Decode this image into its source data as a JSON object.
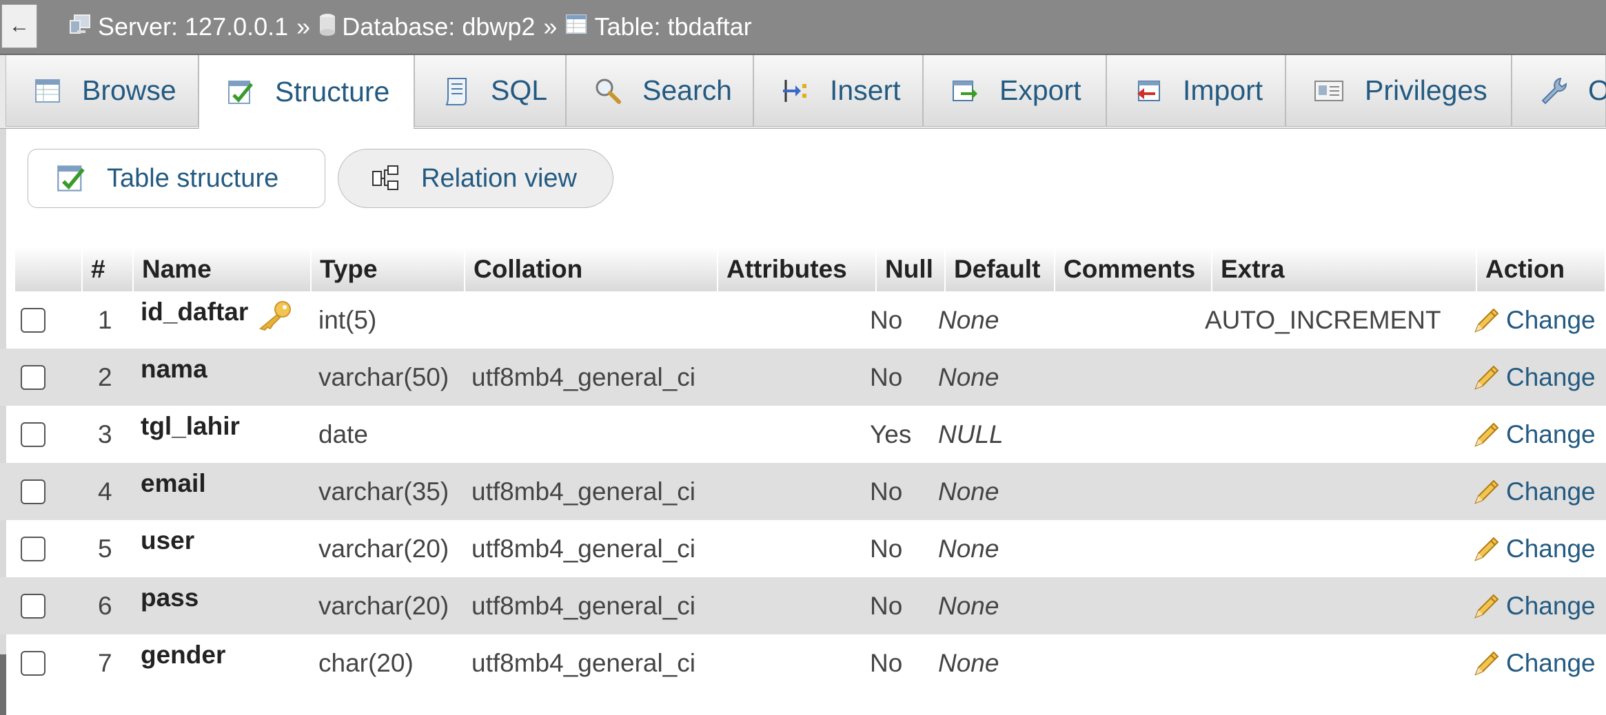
{
  "breadcrumb": {
    "back": "←",
    "server": "Server: 127.0.0.1",
    "database": "Database: dbwp2",
    "table": "Table: tbdaftar",
    "separator": "»"
  },
  "tabs": [
    {
      "label": "Browse",
      "icon": "browse-icon"
    },
    {
      "label": "Structure",
      "icon": "structure-icon",
      "active": true
    },
    {
      "label": "SQL",
      "icon": "sql-icon"
    },
    {
      "label": "Search",
      "icon": "search-icon"
    },
    {
      "label": "Insert",
      "icon": "insert-icon"
    },
    {
      "label": "Export",
      "icon": "export-icon"
    },
    {
      "label": "Import",
      "icon": "import-icon"
    },
    {
      "label": "Privileges",
      "icon": "privileges-icon"
    },
    {
      "label": "O",
      "icon": "wrench-icon"
    }
  ],
  "subtabs": {
    "table_structure": "Table structure",
    "relation_view": "Relation view"
  },
  "table": {
    "headers": [
      "#",
      "Name",
      "Type",
      "Collation",
      "Attributes",
      "Null",
      "Default",
      "Comments",
      "Extra",
      "Action"
    ],
    "rows": [
      {
        "num": "1",
        "name": "id_daftar",
        "primary_key": true,
        "type": "int(5)",
        "collation": "",
        "attributes": "",
        "null": "No",
        "default": "None",
        "comments": "",
        "extra": "AUTO_INCREMENT",
        "action": "Change"
      },
      {
        "num": "2",
        "name": "nama",
        "type": "varchar(50)",
        "collation": "utf8mb4_general_ci",
        "attributes": "",
        "null": "No",
        "default": "None",
        "comments": "",
        "extra": "",
        "action": "Change"
      },
      {
        "num": "3",
        "name": "tgl_lahir",
        "type": "date",
        "collation": "",
        "attributes": "",
        "null": "Yes",
        "default": "NULL",
        "comments": "",
        "extra": "",
        "action": "Change"
      },
      {
        "num": "4",
        "name": "email",
        "type": "varchar(35)",
        "collation": "utf8mb4_general_ci",
        "attributes": "",
        "null": "No",
        "default": "None",
        "comments": "",
        "extra": "",
        "action": "Change"
      },
      {
        "num": "5",
        "name": "user",
        "type": "varchar(20)",
        "collation": "utf8mb4_general_ci",
        "attributes": "",
        "null": "No",
        "default": "None",
        "comments": "",
        "extra": "",
        "action": "Change"
      },
      {
        "num": "6",
        "name": "pass",
        "type": "varchar(20)",
        "collation": "utf8mb4_general_ci",
        "attributes": "",
        "null": "No",
        "default": "None",
        "comments": "",
        "extra": "",
        "action": "Change"
      },
      {
        "num": "7",
        "name": "gender",
        "type": "char(20)",
        "collation": "utf8mb4_general_ci",
        "attributes": "",
        "null": "No",
        "default": "None",
        "comments": "",
        "extra": "",
        "action": "Change"
      }
    ]
  },
  "colors": {
    "link": "#235a81",
    "topbar": "#888888",
    "row_alt": "#dfdfdf"
  }
}
